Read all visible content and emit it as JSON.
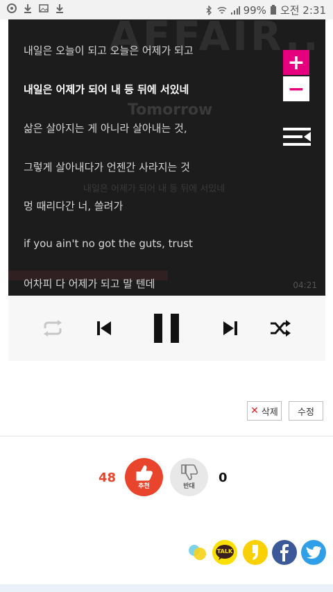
{
  "status_bar": {
    "battery": "99%",
    "time": "오전 2:31",
    "icons": [
      "app-icon",
      "download-icon",
      "image-icon",
      "download-icon",
      "bluetooth-icon",
      "wifi-icon",
      "signal-icon",
      "battery-icon"
    ]
  },
  "player": {
    "background_title": "AFFAIR..",
    "background_subtitle": "Tomorrow",
    "background_line": "내일은 어제가 되어 내 등 뒤에 서있네",
    "background_time": "04:21",
    "lyrics": [
      "내일은 오늘이 되고 오늘은 어제가 되고",
      "내일은 어제가 되어 내 등 뒤에 서있네",
      "삶은 살아지는 게 아니라 살아내는 것,",
      "그렇게 살아내다가 언젠간 사라지는 것",
      "멍 때리다간 너, 쓸려가",
      "if you ain't no got the guts, trust",
      "어차피 다 어제가 되고 말 텐데"
    ],
    "active_lyric_index": 1,
    "zoom_in": "+",
    "zoom_out": "−",
    "accent_color": "#e6007e"
  },
  "controls": [
    "repeat-icon",
    "previous-icon",
    "pause-icon",
    "next-icon",
    "shuffle-icon"
  ],
  "actions": {
    "delete_label": "삭제",
    "edit_label": "수정"
  },
  "votes": {
    "up_count": "48",
    "up_label": "추천",
    "down_label": "반대",
    "down_count": "0",
    "up_color": "#e8452c"
  },
  "share": {
    "kakao_talk_label": "TALK",
    "services": [
      "kakao-story",
      "kakao-talk",
      "kakao-page",
      "facebook",
      "twitter"
    ]
  }
}
